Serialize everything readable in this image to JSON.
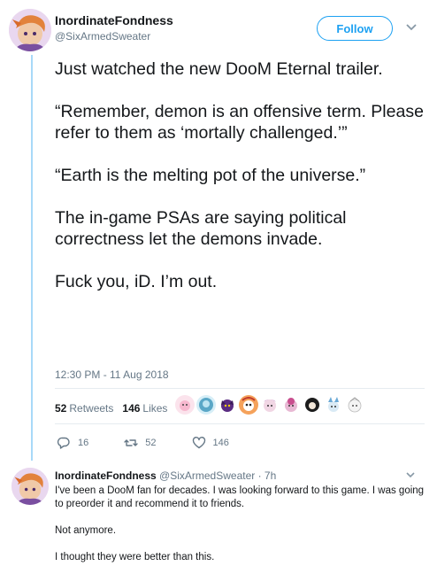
{
  "tweet": {
    "display_name": "InordinateFondness",
    "handle": "@SixArmedSweater",
    "follow_label": "Follow",
    "paragraphs": [
      "Just watched the new DooM Eternal trailer.",
      "“Remember, demon is an offensive term. Please refer to them as ‘mortally challenged.’”",
      "“Earth is the melting pot of the universe.”",
      "The in-game PSAs are saying political correctness let the demons invade.",
      "Fuck you, iD. I’m out."
    ],
    "timestamp": "12:30 PM - 11 Aug 2018",
    "retweets_count": "52",
    "retweets_label": "Retweets",
    "likes_count": "146",
    "likes_label": "Likes",
    "actions": {
      "reply_count": "16",
      "retweet_count": "52",
      "like_count": "146"
    }
  },
  "reply": {
    "display_name": "InordinateFondness",
    "meta": "@SixArmedSweater · 7h",
    "paragraphs": [
      "I've been a DooM fan for decades. I was looking forward to this game. I was going to preorder it and recommend it to friends.",
      "Not anymore.",
      "I thought they were better than this."
    ]
  },
  "colors": {
    "accent": "#1da1f2",
    "thread_line": "#a8d9f8",
    "muted_text": "#657786",
    "divider": "#e6ecf0"
  },
  "icons": {
    "follow_menu": "chevron-down-icon",
    "reply": "reply-icon",
    "retweet": "retweet-icon",
    "like": "heart-icon"
  }
}
